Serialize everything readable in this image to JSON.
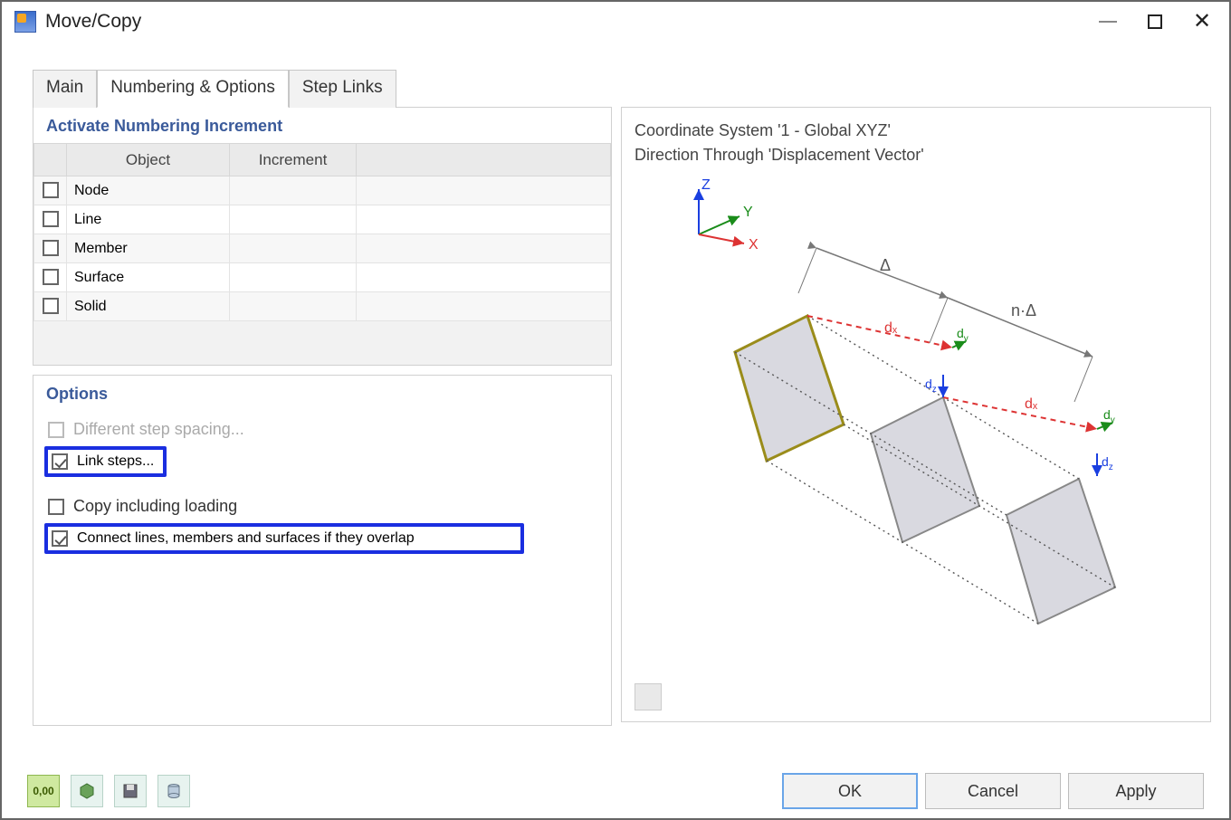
{
  "window": {
    "title": "Move/Copy"
  },
  "tabs": {
    "t0": "Main",
    "t1": "Numbering & Options",
    "t2": "Step Links"
  },
  "numbering": {
    "heading": "Activate Numbering Increment",
    "col_object": "Object",
    "col_increment": "Increment",
    "rows": {
      "r0": "Node",
      "r1": "Line",
      "r2": "Member",
      "r3": "Surface",
      "r4": "Solid"
    }
  },
  "options": {
    "heading": "Options",
    "opt_diff_step": "Different step spacing...",
    "opt_link_steps": "Link steps...",
    "opt_copy_loading": "Copy including loading",
    "opt_connect_overlap": "Connect lines, members and surfaces if they overlap"
  },
  "preview": {
    "line1": "Coordinate System '1 - Global XYZ'",
    "line2": "Direction Through 'Displacement Vector'"
  },
  "buttons": {
    "ok": "OK",
    "cancel": "Cancel",
    "apply": "Apply"
  }
}
